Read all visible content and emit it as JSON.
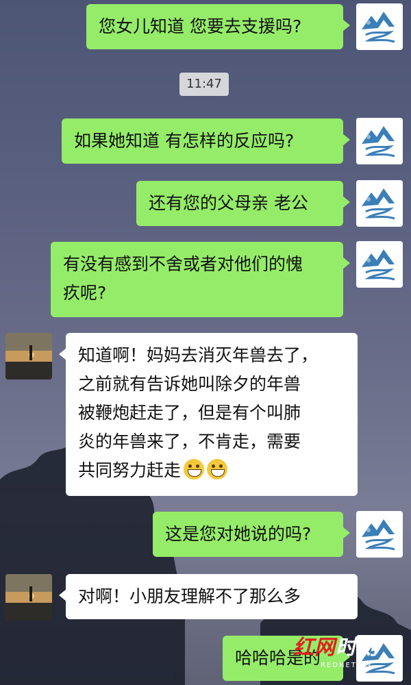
{
  "chat": {
    "time_label": "11:47",
    "messages": [
      {
        "from": "me",
        "text": "您女儿知道 您要去支援吗?"
      },
      {
        "from": "me",
        "text": "如果她知道 有怎样的反应吗?"
      },
      {
        "from": "me",
        "text": "还有您的父母亲 老公"
      },
      {
        "from": "me",
        "lines": [
          "有没有感到不舍或者对他们的愧",
          "疚呢?"
        ]
      },
      {
        "from": "them",
        "lines": [
          "知道啊！妈妈去消灭年兽去了，",
          "之前就有告诉她叫除夕的年兽",
          "被鞭炮赶走了，但是有个叫肺",
          "炎的年兽来了，不肯走，需要",
          "共同努力赶走"
        ],
        "emoji_icon": "grinning-face-icon"
      },
      {
        "from": "me",
        "text": "这是您对她说的吗?"
      },
      {
        "from": "them",
        "text": "对啊！小朋友理解不了那么多"
      },
      {
        "from": "me",
        "text": "哈哈哈是的"
      }
    ]
  },
  "watermark": {
    "brand_red": "红网",
    "brand_white": "时刻",
    "url": "REDNET.CN"
  },
  "colors": {
    "my_bubble": "#95ec69",
    "their_bubble": "#ffffff",
    "time_pill": "#d6d7db"
  }
}
